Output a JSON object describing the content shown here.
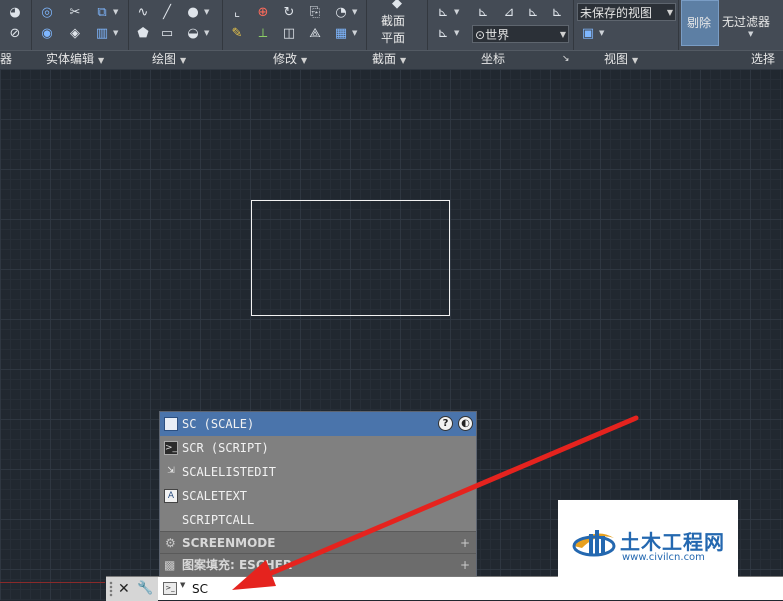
{
  "ribbon": {
    "panels": {
      "solid_edit": "实体编辑",
      "draw": "绘图",
      "modify": "修改",
      "section": "截面",
      "coordinates": "坐标",
      "view": "视图",
      "selection": "选择"
    },
    "section_plane_line1": "截面",
    "section_plane_line2": "平面",
    "ucs_combo": "世界",
    "view_combo": "未保存的视图",
    "cull_label": "剔除",
    "filter_label": "无过滤器"
  },
  "autocomplete": {
    "items": [
      {
        "label": "SC (SCALE)"
      },
      {
        "label": "SCR (SCRIPT)"
      },
      {
        "label": "SCALELISTEDIT"
      },
      {
        "label": "SCALETEXT"
      },
      {
        "label": "SCRIPTCALL"
      }
    ],
    "groups": [
      {
        "label": "SCREENMODE"
      },
      {
        "label": "图案填充: ESCHER"
      }
    ]
  },
  "command_line": {
    "value": "SC"
  },
  "watermark": {
    "title": "土木工程网",
    "url": "www.civilcn.com"
  },
  "colors": {
    "background": "#212830",
    "ribbon": "#444b55",
    "highlight": "#4a74ab",
    "arrow": "#e5231e"
  }
}
